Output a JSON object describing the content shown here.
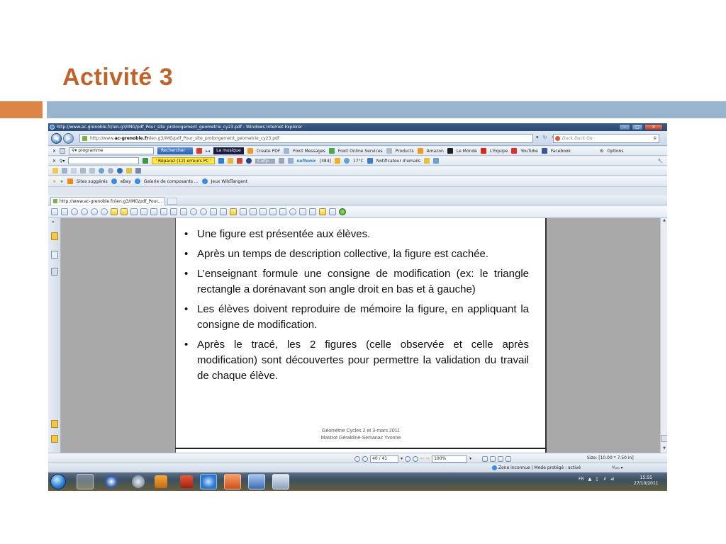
{
  "slide": {
    "title": "Activité 3"
  },
  "colors": {
    "title": "#c0622a",
    "accent_orange": "#dd8447",
    "accent_blue": "#98b4cf"
  },
  "browser": {
    "window_title": "http://www.ac-grenoble.fr/ien.g3/IMG/pdf_Pour_site_prolongement_geometrie_cy23.pdf - Windows Internet Explorer",
    "address_prefix": "http://www.",
    "address_domain": "ac-grenoble.fr",
    "address_rest": "/ien.g3/IMG/pdf_Pour_site_prolongement_geometrie_cy23.pdf",
    "search_placeholder": "Duck Duck Go",
    "tab_label": "http://www.ac-grenoble.fr/ien.g3/IMG/pdf_Pour..."
  },
  "toolbars": {
    "row1": {
      "search_value": "programme",
      "search_button": "Rechercher",
      "music_label": "La musique",
      "items": [
        "Create PDF",
        "Foxit Messages",
        "Foxit Online Services",
        "Products",
        "Amazon",
        "Le Monde",
        "L'Equipe",
        "YouTube",
        "Facebook"
      ],
      "options": "Options"
    },
    "row2": {
      "repair_label": "' Réparez (12) erreurs PC '",
      "caltp_label": "Caltp...",
      "softonic_label": "softonic",
      "softonic_count": "[384]",
      "temperature": "17°C",
      "notifier_label": "Notificateur d'emails"
    },
    "favorites": {
      "items": [
        "Sites suggérés",
        "eBay",
        "Galerie de composants ...",
        "Jeux WildTangent"
      ]
    }
  },
  "pdf": {
    "bullets": [
      "Une figure est présentée aux élèves.",
      "Après un temps de description collective, la figure est cachée.",
      "L’enseignant formule une consigne de modification (ex: le triangle rectangle a dorénavant son angle droit en bas et à gauche)",
      "Les élèves doivent reproduire de mémoire la figure, en appliquant la consigne de modification.",
      "Après le tracé, les 2 figures (celle observée et celle après modification) sont découvertes pour permettre la validation du travail de chaque élève."
    ],
    "footer_line1": "Géométrie Cycles 2 et 3-mars 2011",
    "footer_line2": "Mastrot Géraldine-Semanaz Yvonne",
    "page_indicator": "40 / 41",
    "zoom": "100%",
    "page_size": "Size: [10.00 * 7.50 in]"
  },
  "statusbar": {
    "zone": "Zone inconnue | Mode protégé : activé",
    "zoom_indicator": "⁴⁄₁₀₀ ▾"
  },
  "taskbar": {
    "language": "FR",
    "time": "15:55",
    "date": "27/10/2011"
  }
}
